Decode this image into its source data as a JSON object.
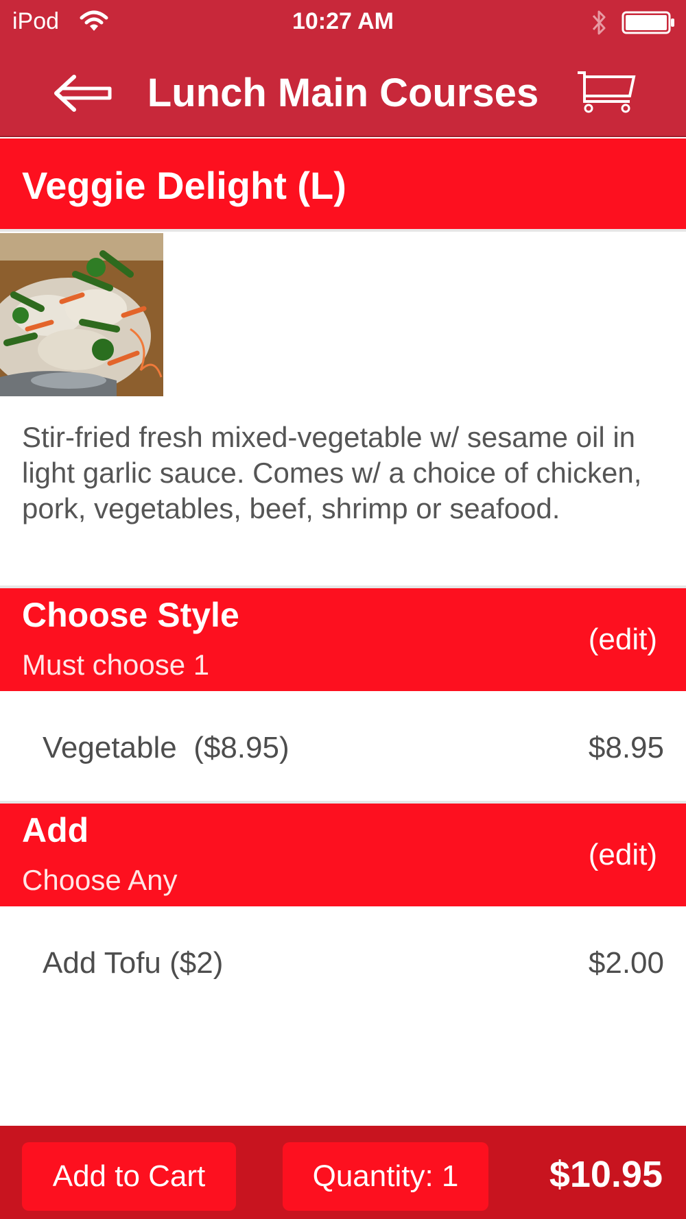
{
  "status_bar": {
    "carrier": "iPod",
    "time": "10:27 AM"
  },
  "nav": {
    "title": "Lunch Main Courses",
    "back_icon": "back-arrow-icon",
    "cart_icon": "cart-icon"
  },
  "item": {
    "title": "Veggie Delight (L)",
    "description": "Stir-fried fresh mixed-vegetable w/ sesame oil in light garlic sauce. Comes w/ a choice of chicken, pork, vegetables, beef, shrimp or seafood."
  },
  "sections": [
    {
      "title": "Choose Style",
      "subtitle": "Must choose 1",
      "edit_label": "(edit)",
      "option": {
        "label": "Vegetable  ($8.95)",
        "price": "$8.95"
      }
    },
    {
      "title": "Add",
      "subtitle": "Choose Any",
      "edit_label": "(edit)",
      "option": {
        "label": "Add Tofu ($2)",
        "price": "$2.00"
      }
    }
  ],
  "footer": {
    "add_to_cart_label": "Add to Cart",
    "quantity_label": "Quantity: 1",
    "total": "$10.95"
  },
  "colors": {
    "nav_red": "#c8283a",
    "section_red": "#fd101f",
    "footer_red": "#c8141f",
    "text_gray": "#4d4d4d"
  }
}
